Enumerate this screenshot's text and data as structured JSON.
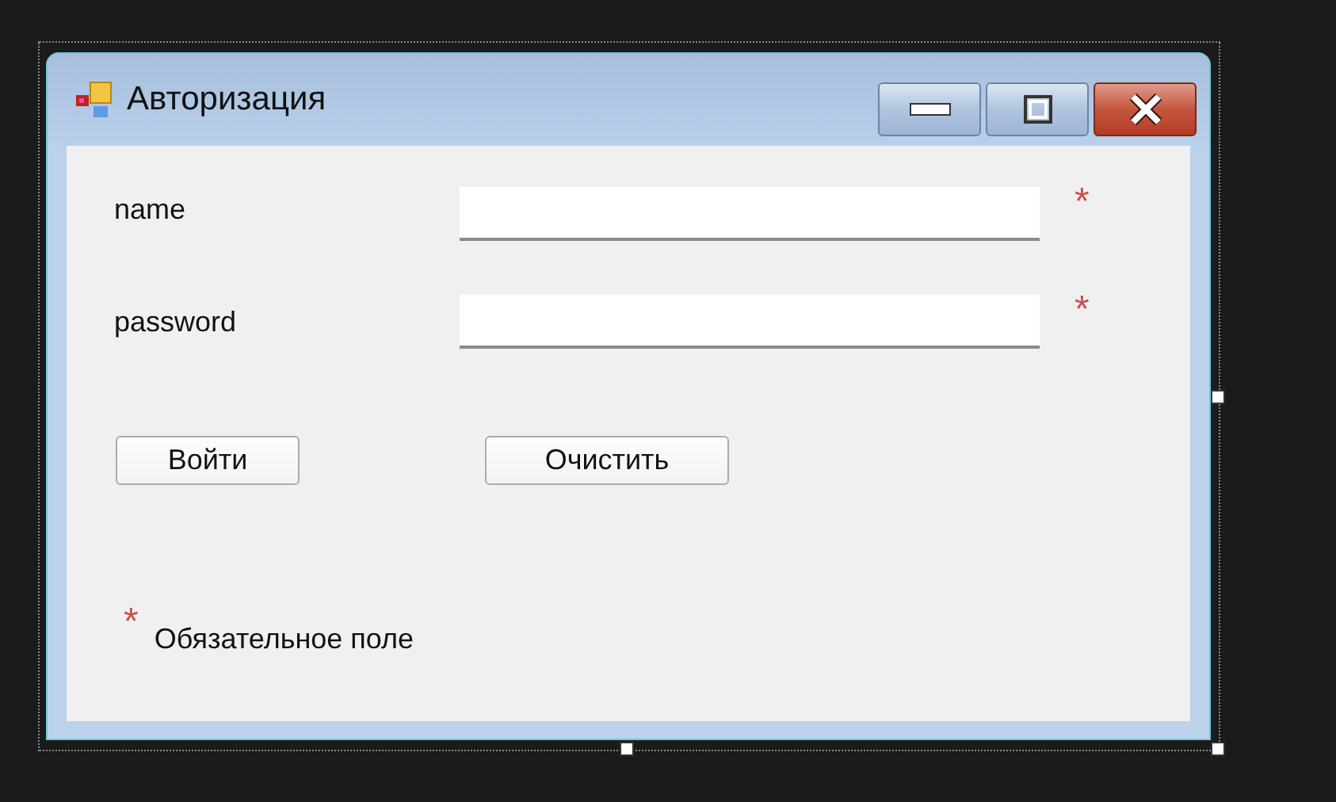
{
  "window": {
    "title": "Авторизация"
  },
  "fields": [
    {
      "label": "name",
      "required_mark": "*"
    },
    {
      "label": "password",
      "required_mark": "*"
    }
  ],
  "buttons": [
    "Войти",
    "Очистить"
  ],
  "legend": {
    "mark": "*",
    "text": "Обязательное поле"
  }
}
